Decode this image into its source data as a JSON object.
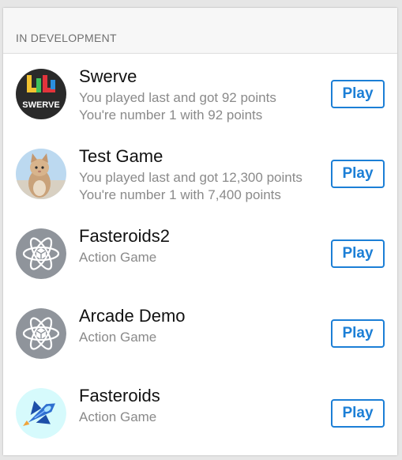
{
  "section": {
    "title": "IN DEVELOPMENT"
  },
  "games": [
    {
      "name": "Swerve",
      "line1": "You played last and got 92 points",
      "line2": "You're number 1 with 92 points",
      "icon": "swerve-logo-icon",
      "play_label": "Play"
    },
    {
      "name": "Test Game",
      "line1": "You played last and got 12,300 points",
      "line2": "You're number 1 with 7,400 points",
      "icon": "kitten-icon",
      "play_label": "Play"
    },
    {
      "name": "Fasteroids2",
      "line1": "Action Game",
      "line2": "",
      "icon": "atom-game-icon",
      "play_label": "Play"
    },
    {
      "name": "Arcade Demo",
      "line1": "Action Game",
      "line2": "",
      "icon": "atom-game-icon",
      "play_label": "Play"
    },
    {
      "name": "Fasteroids",
      "line1": "Action Game",
      "line2": "",
      "icon": "spaceship-icon",
      "play_label": "Play"
    }
  ],
  "swerve_logo_text": "SWERVE",
  "colors": {
    "accent": "#1c7fd6",
    "secondary_text": "#8a8a8a",
    "atom_bg": "#8f949b"
  }
}
